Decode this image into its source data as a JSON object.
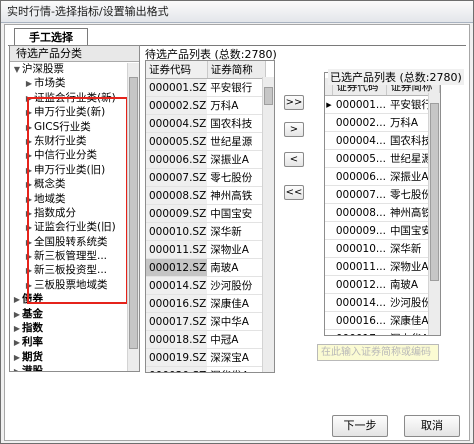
{
  "window": {
    "title": "实时行情-选择指标/设置输出格式"
  },
  "tab": {
    "label": "手工选择"
  },
  "left_panel": {
    "header": "待选产品分类",
    "root": "沪深股票",
    "children": [
      "市场类",
      "证监会行业类(新)",
      "申万行业类(新)",
      "GICS行业类",
      "东财行业类",
      "中信行业分类",
      "申万行业类(旧)",
      "概念类",
      "地域类",
      "指数成分",
      "证监会行业类(旧)",
      "全国股转系统类",
      "新三板管理型...",
      "新三板投资型...",
      "三板股票地域类"
    ],
    "top_items": [
      "债券",
      "基金",
      "指数",
      "利率",
      "期货",
      "港股"
    ]
  },
  "middle": {
    "title": "待选产品列表 (总数:2780)",
    "headers": [
      "证券代码",
      "证券简称"
    ],
    "rows": [
      [
        "000001.SZ",
        "平安银行"
      ],
      [
        "000002.SZ",
        "万科A"
      ],
      [
        "000004.SZ",
        "国农科技"
      ],
      [
        "000005.SZ",
        "世纪星源"
      ],
      [
        "000006.SZ",
        "深振业A"
      ],
      [
        "000007.SZ",
        "零七股份"
      ],
      [
        "000008.SZ",
        "神州高铁"
      ],
      [
        "000009.SZ",
        "中国宝安"
      ],
      [
        "000010.SZ",
        "深华新"
      ],
      [
        "000011.SZ",
        "深物业A"
      ],
      [
        "000012.SZ",
        "南玻A"
      ],
      [
        "000014.SZ",
        "沙河股份"
      ],
      [
        "000016.SZ",
        "深康佳A"
      ],
      [
        "000017.SZ",
        "深中华A"
      ],
      [
        "000018.SZ",
        "中冠A"
      ],
      [
        "000019.SZ",
        "深深宝A"
      ],
      [
        "000020.SZ",
        "深华发A"
      ],
      [
        "000021.SZ",
        "深科技"
      ]
    ]
  },
  "right": {
    "title": "已选产品列表 (总数:2780)",
    "headers": [
      "证券代码",
      "证券简称"
    ],
    "rows": [
      [
        "000001...",
        "平安银行"
      ],
      [
        "000002...",
        "万科A"
      ],
      [
        "000004...",
        "国农科技"
      ],
      [
        "000005...",
        "世纪星源"
      ],
      [
        "000006...",
        "深振业A"
      ],
      [
        "000007...",
        "零七股份"
      ],
      [
        "000008...",
        "神州高铁"
      ],
      [
        "000009...",
        "中国宝安"
      ],
      [
        "000010...",
        "深华新"
      ],
      [
        "000011...",
        "深物业A"
      ],
      [
        "000012...",
        "南玻A"
      ],
      [
        "000014...",
        "沙河股份"
      ],
      [
        "000016...",
        "深康佳A"
      ],
      [
        "000017...",
        "深中华A"
      ],
      [
        "000018...",
        "中冠A"
      ]
    ]
  },
  "buttons": {
    "add_all": ">>",
    "add": ">",
    "remove": "<",
    "remove_all": "<<",
    "next": "下一步",
    "cancel": "取消"
  },
  "search": {
    "placeholder": "在此输入证券简称或编码"
  }
}
